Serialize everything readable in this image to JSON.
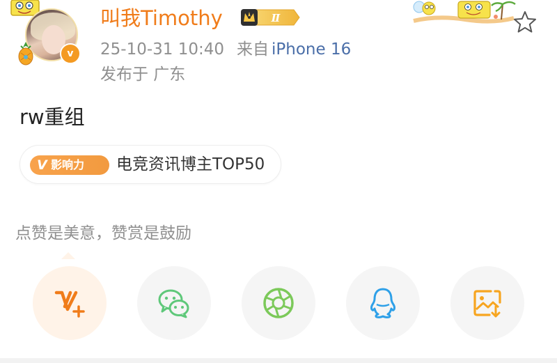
{
  "post": {
    "author": {
      "name": "叫我Timothy",
      "member_level": "Ⅱ",
      "verified_mark": "v"
    },
    "timestamp": "25-10-31 10:40",
    "source_prefix": "来自",
    "source": "iPhone 16",
    "location": "发布于 广东",
    "text": "rw重组",
    "influence": {
      "tag_mark": "V",
      "tag_label": "影响力",
      "label": "电竞资讯博主TOP50"
    }
  },
  "appreciate": {
    "prompt": "点赞是美意，赞赏是鼓励"
  },
  "share_actions": [
    {
      "icon": "reward-v-plus-icon"
    },
    {
      "icon": "wechat-icon"
    },
    {
      "icon": "moments-aperture-icon"
    },
    {
      "icon": "qq-penguin-icon"
    },
    {
      "icon": "save-image-icon"
    }
  ],
  "colors": {
    "username": "#f07c1a",
    "meta_gray": "#8f8f8f",
    "source_blue": "#4a6ea8",
    "reward_orange": "#f07c1a",
    "wechat_green": "#5fc87a",
    "moments_green": "#7cc95a",
    "qq_blue": "#2ea0e8",
    "save_orange": "#f7a520"
  }
}
